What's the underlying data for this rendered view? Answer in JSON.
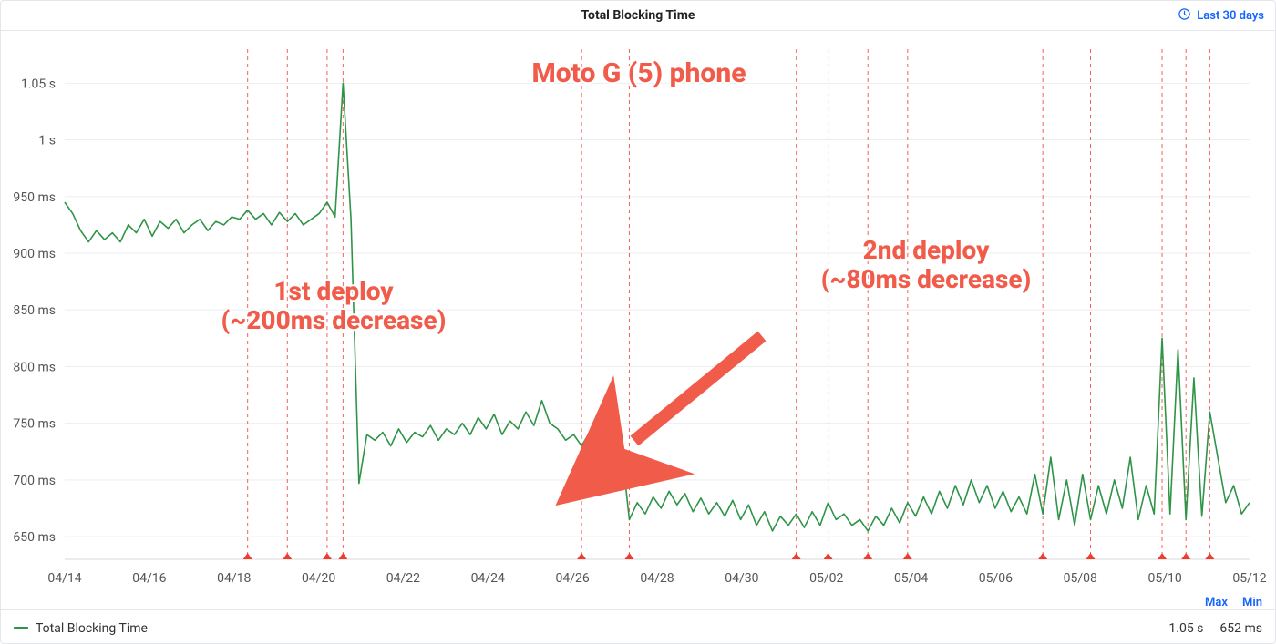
{
  "header": {
    "title": "Total Blocking Time",
    "range_label": "Last 30 days"
  },
  "legend": {
    "series_label": "Total Blocking Time",
    "max_label": "Max",
    "min_label": "Min",
    "max_value": "1.05 s",
    "min_value": "652 ms"
  },
  "annotations": {
    "title": "Moto G (5) phone",
    "deploy1_line1": "1st deploy",
    "deploy1_line2": "(~200ms decrease)",
    "deploy2_line1": "2nd deploy",
    "deploy2_line2": "(~80ms decrease)"
  },
  "chart_data": {
    "type": "line",
    "title": "Total Blocking Time",
    "ylabel": "",
    "xlabel": "",
    "ylim_ms": [
      630,
      1080
    ],
    "y_ticks_ms": [
      650,
      700,
      750,
      800,
      850,
      900,
      950,
      1000,
      1050
    ],
    "y_tick_labels": [
      "650 ms",
      "700 ms",
      "750 ms",
      "800 ms",
      "850 ms",
      "900 ms",
      "950 ms",
      "1 s",
      "1.05 s"
    ],
    "x_tick_labels": [
      "04/14",
      "04/16",
      "04/18",
      "04/20",
      "04/22",
      "04/24",
      "04/26",
      "04/28",
      "04/30",
      "05/02",
      "05/04",
      "05/06",
      "05/08",
      "05/10",
      "05/12"
    ],
    "x_range_index": [
      0,
      149
    ],
    "deploy_marker_indices": [
      23,
      28,
      33,
      35,
      65,
      71,
      92,
      96,
      101,
      106,
      123,
      129,
      138,
      141,
      144
    ],
    "series": [
      {
        "name": "Total Blocking Time",
        "color": "#2e9447",
        "values_ms": [
          945,
          935,
          920,
          910,
          920,
          912,
          918,
          910,
          925,
          918,
          930,
          915,
          928,
          922,
          930,
          918,
          925,
          930,
          920,
          928,
          925,
          932,
          930,
          938,
          930,
          935,
          925,
          936,
          928,
          935,
          925,
          930,
          935,
          945,
          932,
          1050,
          930,
          697,
          740,
          735,
          742,
          730,
          745,
          733,
          742,
          738,
          748,
          735,
          745,
          740,
          750,
          740,
          755,
          745,
          758,
          740,
          752,
          745,
          760,
          748,
          770,
          750,
          745,
          735,
          740,
          730,
          742,
          720,
          735,
          715,
          730,
          665,
          680,
          670,
          685,
          675,
          690,
          678,
          688,
          672,
          684,
          670,
          680,
          668,
          682,
          665,
          678,
          660,
          672,
          655,
          668,
          660,
          670,
          658,
          672,
          660,
          680,
          665,
          670,
          660,
          665,
          655,
          668,
          660,
          675,
          662,
          680,
          668,
          685,
          670,
          690,
          675,
          695,
          678,
          700,
          680,
          695,
          675,
          690,
          672,
          685,
          670,
          705,
          670,
          720,
          665,
          700,
          660,
          705,
          665,
          695,
          670,
          700,
          675,
          720,
          665,
          695,
          670,
          825,
          670,
          815,
          665,
          790,
          668,
          760,
          720,
          680,
          695,
          670,
          680
        ]
      }
    ]
  }
}
